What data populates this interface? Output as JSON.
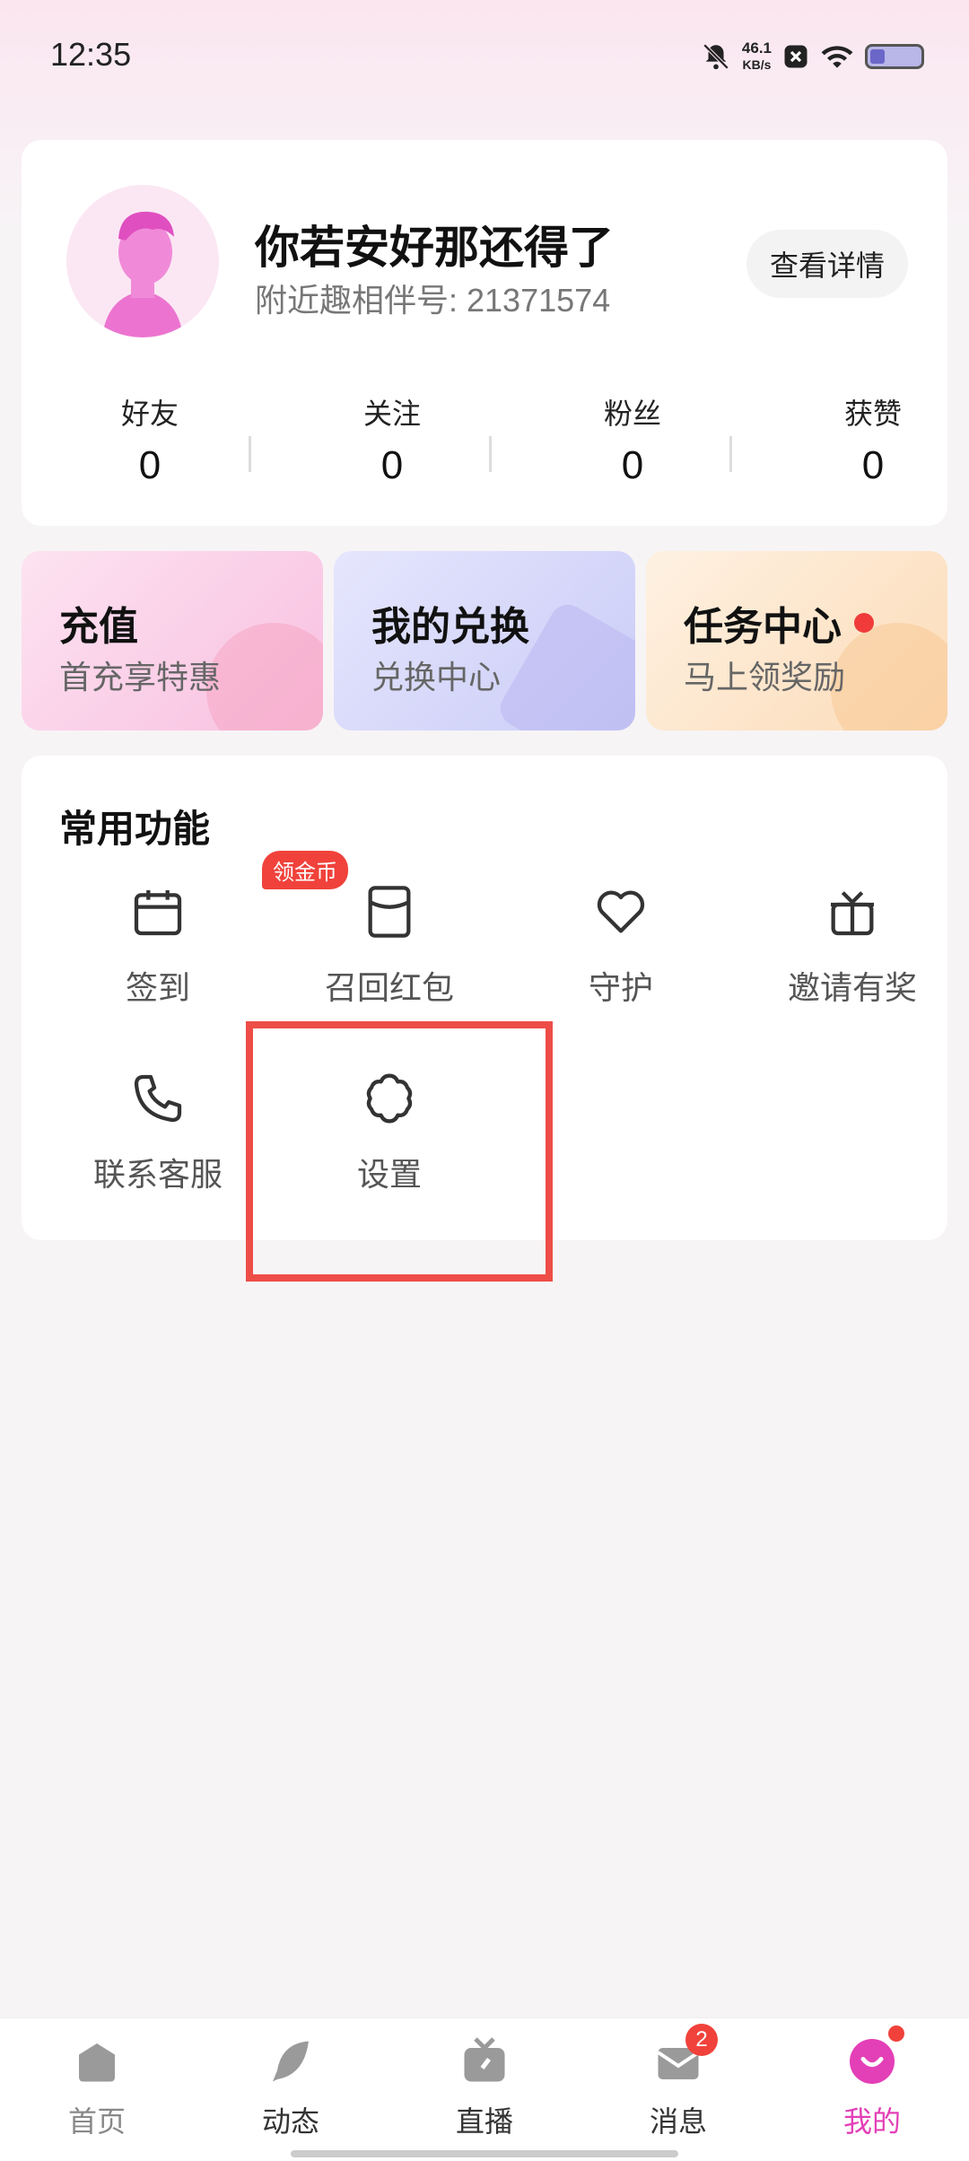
{
  "status_bar": {
    "time": "12:35",
    "net_speed_value": "46.1",
    "net_speed_unit": "KB/s",
    "icons": [
      "bell-off-icon",
      "close-box-icon",
      "wifi-icon",
      "battery-icon"
    ]
  },
  "profile": {
    "username": "你若安好那还得了",
    "id_label": "附近趣相伴号: ",
    "id_value": "21371574",
    "detail_button": "查看详情",
    "stats": [
      {
        "label": "好友",
        "value": "0"
      },
      {
        "label": "关注",
        "value": "0"
      },
      {
        "label": "粉丝",
        "value": "0"
      },
      {
        "label": "获赞",
        "value": "0"
      }
    ]
  },
  "promos": [
    {
      "title": "充值",
      "subtitle": "首充享特惠",
      "color": "#fbd3ea"
    },
    {
      "title": "我的兑换",
      "subtitle": "兑换中心",
      "color": "#dcdcfb"
    },
    {
      "title": "任务中心",
      "subtitle": "马上领奖励",
      "color": "#fde8cf"
    }
  ],
  "features": {
    "title": "常用功能",
    "coin_badge": "领金币",
    "items": [
      {
        "label": "签到",
        "icon": "calendar-icon"
      },
      {
        "label": "召回红包",
        "icon": "red-packet-icon"
      },
      {
        "label": "守护",
        "icon": "heart-icon"
      },
      {
        "label": "邀请有奖",
        "icon": "gift-icon"
      },
      {
        "label": "联系客服",
        "icon": "phone-icon"
      },
      {
        "label": "设置",
        "icon": "settings-icon"
      }
    ]
  },
  "bottom_nav": {
    "items": [
      {
        "label": "首页",
        "icon": "home-icon"
      },
      {
        "label": "动态",
        "icon": "feather-icon"
      },
      {
        "label": "直播",
        "icon": "tv-icon"
      },
      {
        "label": "消息",
        "icon": "mail-icon",
        "badge": "2"
      },
      {
        "label": "我的",
        "icon": "me-icon",
        "active": true
      }
    ]
  },
  "colors": {
    "accent": "#e33fb7",
    "badge": "#f0423b",
    "highlight": "#ee4d47"
  }
}
